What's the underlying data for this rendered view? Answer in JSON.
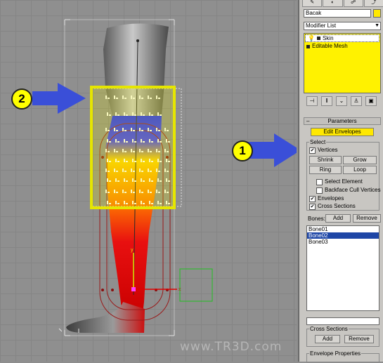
{
  "viewport": {
    "watermark": "www.TR3D.com",
    "callout_1": "1",
    "callout_2": "2",
    "colors": {
      "skin_gray": "#8a8a8a",
      "weight_red": "#e01010",
      "weight_yellow": "#ffb000",
      "weight_blue": "#1a2aff",
      "highlight": "#e6e600",
      "callout_arrow": "#3a4fd8",
      "callout_circle": "#ffff00"
    }
  },
  "panel": {
    "tabs": [
      "create-icon",
      "modify-icon",
      "hierarchy-icon",
      "motion-icon"
    ],
    "object_name": "Bacak",
    "object_color": "#ffe800",
    "modifier_list": "Modifier List",
    "stack": [
      {
        "label": "Skin",
        "selected": true,
        "icon": "bulb-icon"
      },
      {
        "label": "Editable Mesh",
        "selected": false,
        "icon": "square-icon"
      }
    ],
    "parameters": {
      "header": "Parameters",
      "edit_envelopes": "Edit Envelopes",
      "select_group": "Select",
      "vertices": "Vertices",
      "vertices_checked": true,
      "shrink": "Shrink",
      "grow": "Grow",
      "ring": "Ring",
      "loop": "Loop",
      "select_element": "Select Element",
      "select_element_checked": false,
      "backface_cull": "Backface Cull Vertices",
      "backface_cull_checked": false,
      "envelopes": "Envelopes",
      "envelopes_checked": true,
      "cross_sections": "Cross Sections",
      "cross_sections_checked": true,
      "bones_label": "Bones:",
      "add": "Add",
      "remove": "Remove",
      "bones": [
        "Bone01",
        "Bone02",
        "Bone03"
      ],
      "selected_bone": "Bone02",
      "cross_sections_group": "Cross Sections",
      "cs_add": "Add",
      "cs_remove": "Remove",
      "envelope_properties": "Envelope Properties"
    }
  }
}
